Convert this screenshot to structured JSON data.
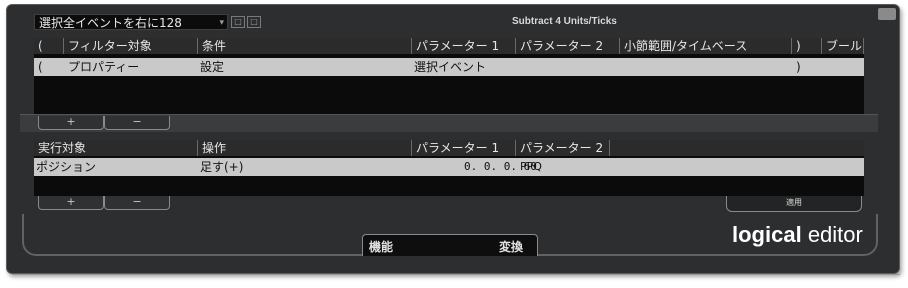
{
  "toolbar": {
    "preset_value": "選択全イベントを右に128",
    "preset_caret": "▾",
    "icon_btn_1": "□",
    "icon_btn_2": "□"
  },
  "window_title": "Subtract 4 Units/Ticks",
  "filter": {
    "headers": [
      "(",
      "フィルター対象",
      "条件",
      "パラメーター 1",
      "パラメーター 2",
      "小節範囲/タイムベース",
      ")",
      "ブール"
    ],
    "row": {
      "open_paren": "(",
      "target": "プロパティー",
      "condition": "設定",
      "param1": "選択イベント",
      "param2": "",
      "bar_range": "",
      "close_paren": ")",
      "bool": ""
    },
    "add_label": "+",
    "remove_label": "−"
  },
  "action": {
    "headers": [
      "実行対象",
      "操作",
      "パラメーター 1",
      "パラメーター 2"
    ],
    "row": {
      "target": "ポジション",
      "operation": "足す(+)",
      "param1": "0. 0. 0. 60",
      "param2": "PPQ"
    },
    "add_label": "+",
    "remove_label": "−"
  },
  "apply_label": "適用",
  "modes": {
    "function": "機能",
    "transform": "変換"
  },
  "logo": {
    "bold": "logical",
    "normal": "editor"
  },
  "colors": {
    "background": "#2c2e2f",
    "selected_row": "#c9c9c9",
    "header_cell": "#2b2b2b"
  }
}
